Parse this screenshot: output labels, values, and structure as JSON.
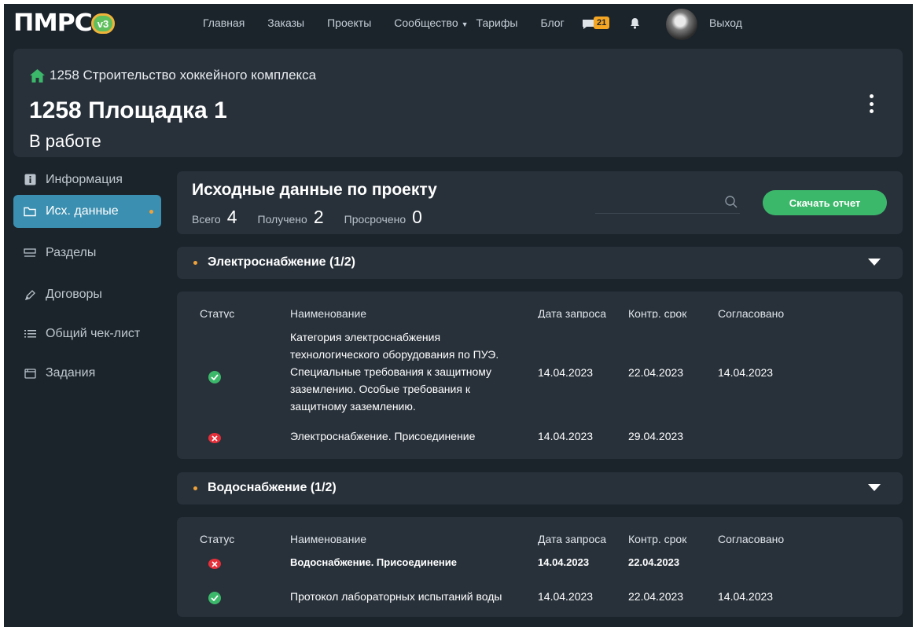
{
  "brand": {
    "logo_text": "ПМРС",
    "version_badge": "v3"
  },
  "nav": {
    "items": [
      "Главная",
      "Заказы",
      "Проекты",
      "Сообщество",
      "Тарифы",
      "Блог"
    ],
    "messages_count": "21",
    "logout_label": "Выход"
  },
  "project": {
    "breadcrumb": "1258 Строительство хоккейного комплекса",
    "title": "1258 Площадка 1",
    "status": "В работе"
  },
  "sidebar": {
    "items": [
      {
        "label": "Информация",
        "icon": "info-icon"
      },
      {
        "label": "Исх. данные",
        "icon": "folder-icon",
        "active": true
      },
      {
        "label": "Разделы",
        "icon": "sections-icon"
      },
      {
        "label": "Договоры",
        "icon": "pen-icon"
      },
      {
        "label": "Общий чек-лист",
        "icon": "checklist-icon"
      },
      {
        "label": "Задания",
        "icon": "tasks-icon"
      }
    ]
  },
  "summary": {
    "title": "Исходные данные по проекту",
    "total_label": "Всего",
    "total": "4",
    "received_label": "Получено",
    "received": "2",
    "overdue_label": "Просрочено",
    "overdue": "0",
    "download_label": "Скачать отчет"
  },
  "columns": {
    "status": "Статус",
    "name": "Наименование",
    "request_date": "Дата запроса",
    "control_date": "Контр. срок",
    "approved": "Согласовано"
  },
  "groups": [
    {
      "title": "Электроснабжение (1/2)",
      "rows": [
        {
          "status": "ok",
          "name": "Категория электроснабжения технологического оборудования по ПУЭ. Специальные требования к защитному заземлению. Особые требования к защитному заземлению.",
          "request_date": "14.04.2023",
          "control_date": "22.04.2023",
          "approved": "14.04.2023"
        },
        {
          "status": "overdue",
          "name": "Электроснабжение. Присоединение",
          "request_date": "14.04.2023",
          "control_date": "29.04.2023",
          "approved": ""
        }
      ]
    },
    {
      "title": "Водоснабжение (1/2)",
      "rows": [
        {
          "status": "overdue",
          "name": "Водоснабжение. Присоединение",
          "request_date": "14.04.2023",
          "control_date": "22.04.2023",
          "approved": ""
        },
        {
          "status": "ok",
          "name": "Протокол лабораторных испытаний воды",
          "request_date": "14.04.2023",
          "control_date": "22.04.2023",
          "approved": "14.04.2023"
        }
      ]
    }
  ],
  "colors": {
    "accent": "#3b8fb0",
    "success": "#3cb86b",
    "danger": "#e5303a",
    "warning": "#f0a23a",
    "background": "#1b232b",
    "card": "#28313a"
  }
}
